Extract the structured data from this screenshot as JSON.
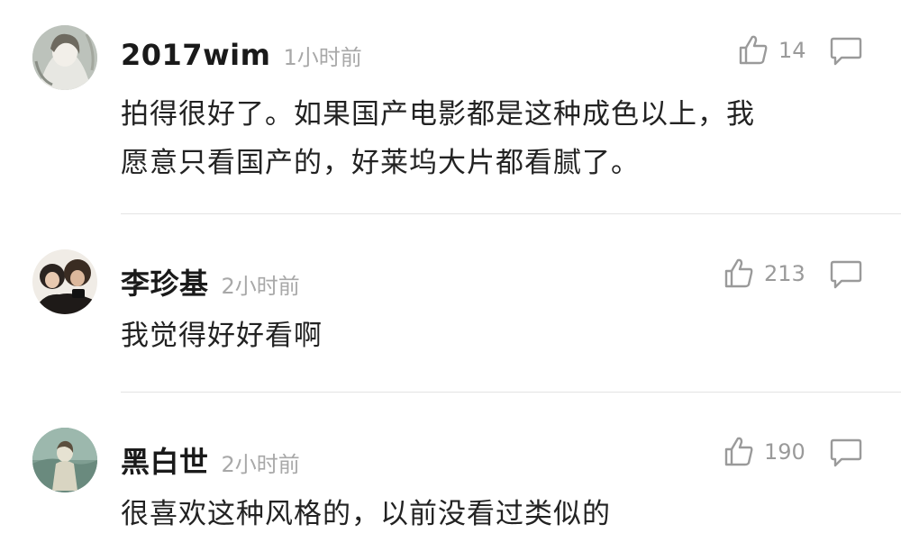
{
  "comments": [
    {
      "username": "2017wim",
      "time": "1小时前",
      "likes": "14",
      "text_lines": [
        "拍得很好了。如果国产电影都是这种成色以上，我",
        "愿意只看国产的，好莱坞大片都看腻了。"
      ]
    },
    {
      "username": "李珍基",
      "time": "2小时前",
      "likes": "213",
      "text_lines": [
        "我觉得好好看啊"
      ]
    },
    {
      "username": "黑白世",
      "time": "2小时前",
      "likes": "190",
      "text_lines": [
        "很喜欢这种风格的，以前没看过类似的"
      ]
    }
  ],
  "icons": {
    "like": "thumbs-up-icon",
    "reply": "comment-bubble-icon"
  },
  "colors": {
    "username": "#1a1a1a",
    "meta": "#a8a8a8",
    "icon": "#9a9a9a",
    "divider": "#e4e4e4"
  }
}
